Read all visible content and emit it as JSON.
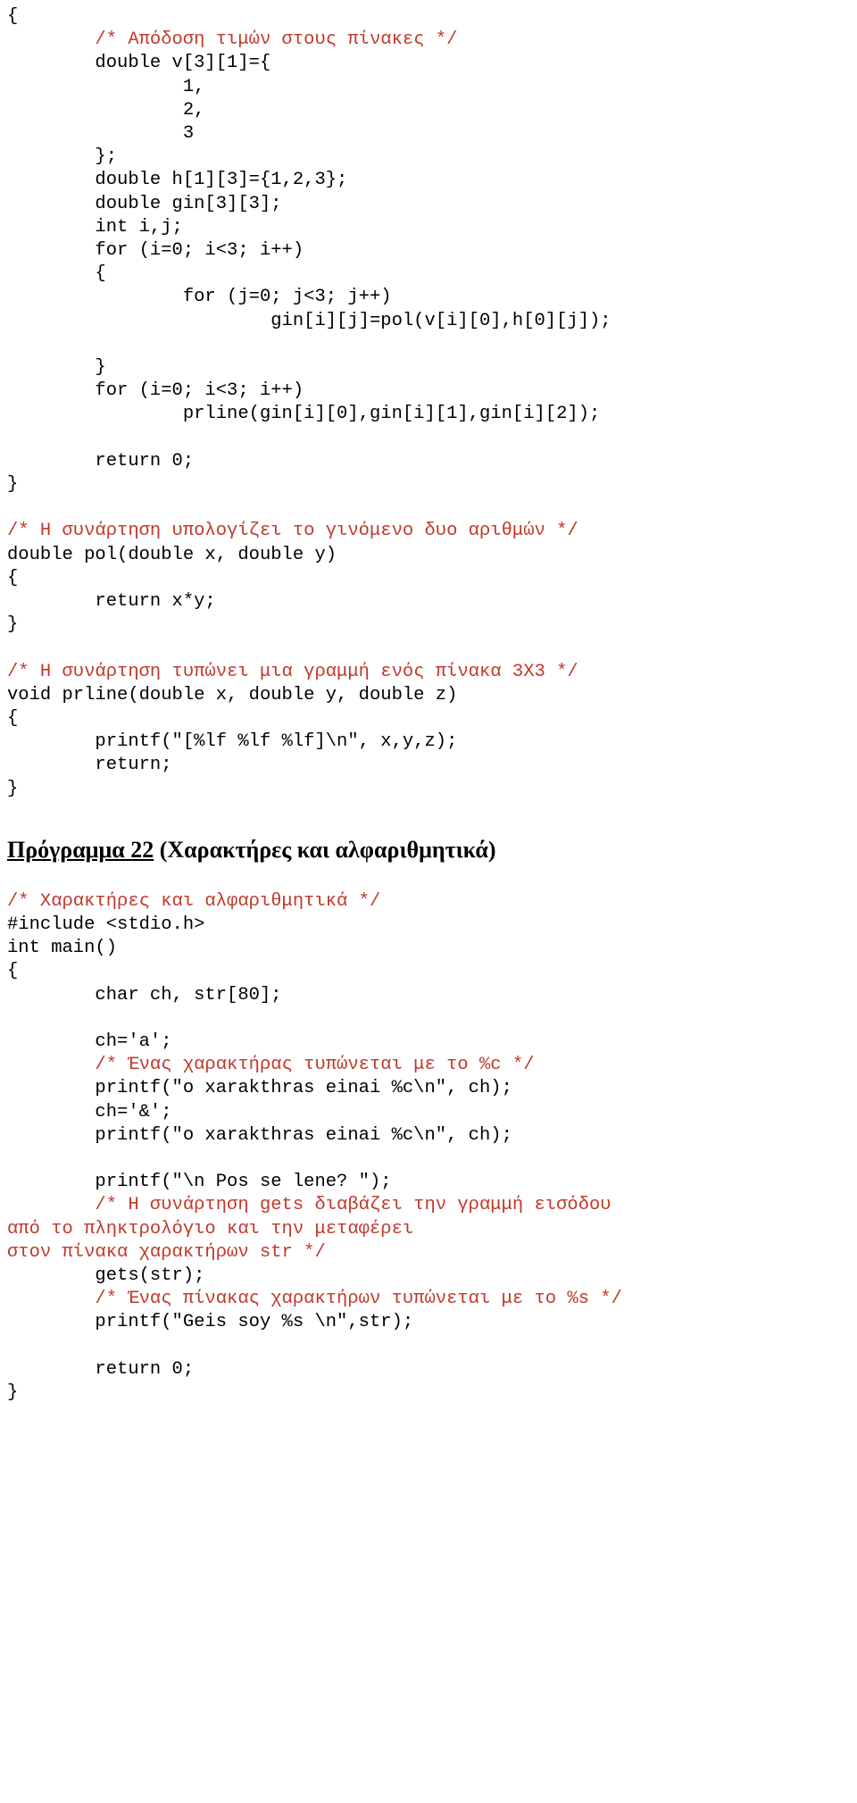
{
  "document": {
    "language": "Greek",
    "text_color": "#000000",
    "comment_color": "#c0392b",
    "background_color": "#ffffff"
  },
  "program_21_tail": {
    "lines": [
      {
        "text": "{",
        "type": "code"
      },
      {
        "text": "        /* Απόδοση τιμών στους πίνακες */",
        "type": "comment"
      },
      {
        "text": "        double v[3][1]={",
        "type": "code"
      },
      {
        "text": "                1,",
        "type": "code"
      },
      {
        "text": "                2,",
        "type": "code"
      },
      {
        "text": "                3",
        "type": "code"
      },
      {
        "text": "        };",
        "type": "code"
      },
      {
        "text": "        double h[1][3]={1,2,3};",
        "type": "code"
      },
      {
        "text": "        double gin[3][3];",
        "type": "code"
      },
      {
        "text": "        int i,j;",
        "type": "code"
      },
      {
        "text": "        for (i=0; i<3; i++)",
        "type": "code"
      },
      {
        "text": "        {",
        "type": "code"
      },
      {
        "text": "                for (j=0; j<3; j++)",
        "type": "code"
      },
      {
        "text": "                        gin[i][j]=pol(v[i][0],h[0][j]);",
        "type": "code"
      },
      {
        "text": "",
        "type": "blank"
      },
      {
        "text": "        }",
        "type": "code"
      },
      {
        "text": "        for (i=0; i<3; i++)",
        "type": "code"
      },
      {
        "text": "                prline(gin[i][0],gin[i][1],gin[i][2]);",
        "type": "code"
      },
      {
        "text": "",
        "type": "blank"
      },
      {
        "text": "        return 0;",
        "type": "code"
      },
      {
        "text": "}",
        "type": "code"
      },
      {
        "text": "",
        "type": "blank"
      },
      {
        "text": "/* Η συνάρτηση υπολογίζει το γινόμενο δυο αριθμών */",
        "type": "comment"
      },
      {
        "text": "double pol(double x, double y)",
        "type": "code"
      },
      {
        "text": "{",
        "type": "code"
      },
      {
        "text": "        return x*y;",
        "type": "code"
      },
      {
        "text": "}",
        "type": "code"
      },
      {
        "text": "",
        "type": "blank"
      },
      {
        "text": "/* Η συνάρτηση τυπώνει μια γραμμή ενός πίνακα 3Χ3 */",
        "type": "comment"
      },
      {
        "text": "void prline(double x, double y, double z)",
        "type": "code"
      },
      {
        "text": "{",
        "type": "code"
      },
      {
        "text": "        printf(\"[%lf %lf %lf]\\n\", x,y,z);",
        "type": "code"
      },
      {
        "text": "        return;",
        "type": "code"
      },
      {
        "text": "}",
        "type": "code"
      }
    ]
  },
  "heading": {
    "underlined_part": "Πρόγραμμα 22",
    "rest": " (Χαρακτήρες και αλφαριθμητικά)"
  },
  "program_22": {
    "lines": [
      {
        "text": "/* Χαρακτήρες και αλφαριθμητικά */",
        "type": "comment"
      },
      {
        "text": "#include <stdio.h>",
        "type": "code"
      },
      {
        "text": "int main()",
        "type": "code"
      },
      {
        "text": "{",
        "type": "code"
      },
      {
        "text": "        char ch, str[80];",
        "type": "code"
      },
      {
        "text": "",
        "type": "blank"
      },
      {
        "text": "        ch='a';",
        "type": "code"
      },
      {
        "text": "        /* Ένας χαρακτήρας τυπώνεται με το %c */",
        "type": "comment"
      },
      {
        "text": "        printf(\"o xarakthras einai %c\\n\", ch);",
        "type": "code"
      },
      {
        "text": "        ch='&';",
        "type": "code"
      },
      {
        "text": "        printf(\"o xarakthras einai %c\\n\", ch);",
        "type": "code"
      },
      {
        "text": "",
        "type": "blank"
      },
      {
        "text": "        printf(\"\\n Pos se lene? \");",
        "type": "code"
      },
      {
        "text": "        /* Η συνάρτηση gets διαβάζει την γραμμή εισόδου",
        "type": "comment"
      },
      {
        "text": "από το πληκτρολόγιο και την μεταφέρει",
        "type": "comment"
      },
      {
        "text": "στον πίνακα χαρακτήρων str */",
        "type": "comment"
      },
      {
        "text": "        gets(str);",
        "type": "code"
      },
      {
        "text": "        /* Ένας πίνακας χαρακτήρων τυπώνεται με το %s */",
        "type": "comment"
      },
      {
        "text": "        printf(\"Geis soy %s \\n\",str);",
        "type": "code"
      },
      {
        "text": "",
        "type": "blank"
      },
      {
        "text": "        return 0;",
        "type": "code"
      },
      {
        "text": "}",
        "type": "code"
      }
    ]
  }
}
